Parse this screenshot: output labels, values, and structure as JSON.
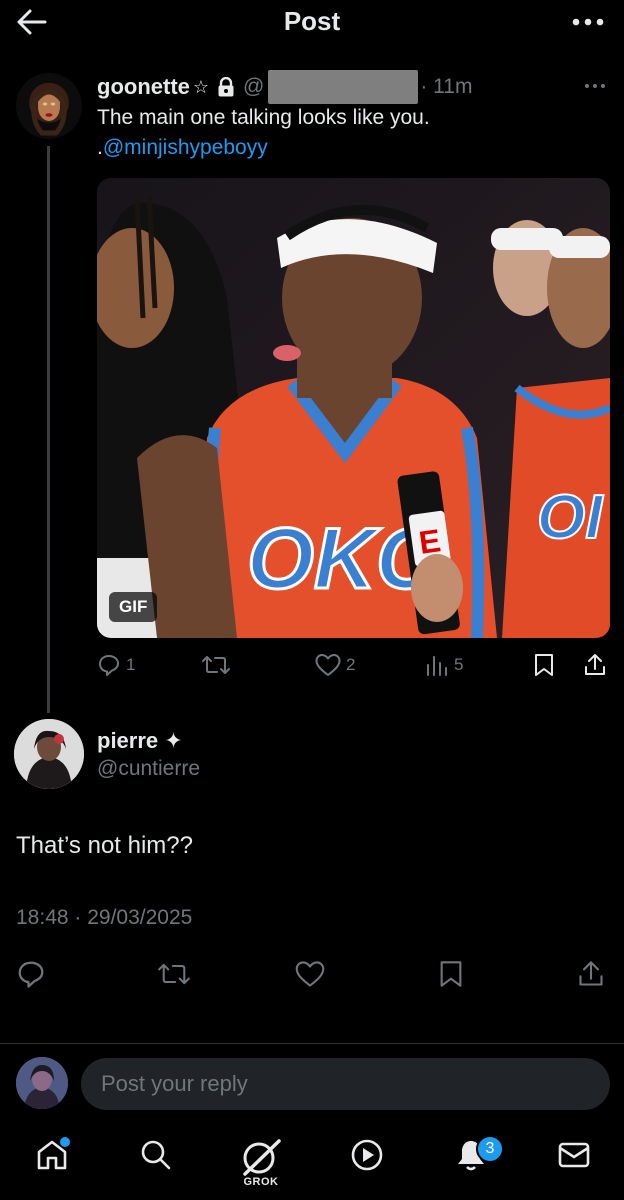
{
  "header": {
    "title": "Post",
    "back_icon": "arrow-left-icon",
    "more_icon": "more-horizontal-icon"
  },
  "post": {
    "display_name": "goonette",
    "badge": "☆",
    "handle_prefix": "@",
    "time": "· 11m",
    "text_before": "The main one talking looks like you. .",
    "mention": "@minjishypeboyy",
    "media_badge": "GIF",
    "actions": {
      "reply_count": "1",
      "repost_count": "",
      "like_count": "2",
      "views_count": "5"
    }
  },
  "reply": {
    "display_name": "pierre",
    "badge": "✦",
    "handle": "@cuntierre",
    "text": "That’s not him??",
    "timestamp": "18:48 · 29/03/2025"
  },
  "composer": {
    "placeholder": "Post your reply"
  },
  "nav": {
    "grok_label": "GROK",
    "notifications_badge": "3"
  },
  "colors": {
    "background": "#000000",
    "text": "#e7e9ea",
    "muted": "#71767b",
    "accent": "#1d9bf0"
  }
}
